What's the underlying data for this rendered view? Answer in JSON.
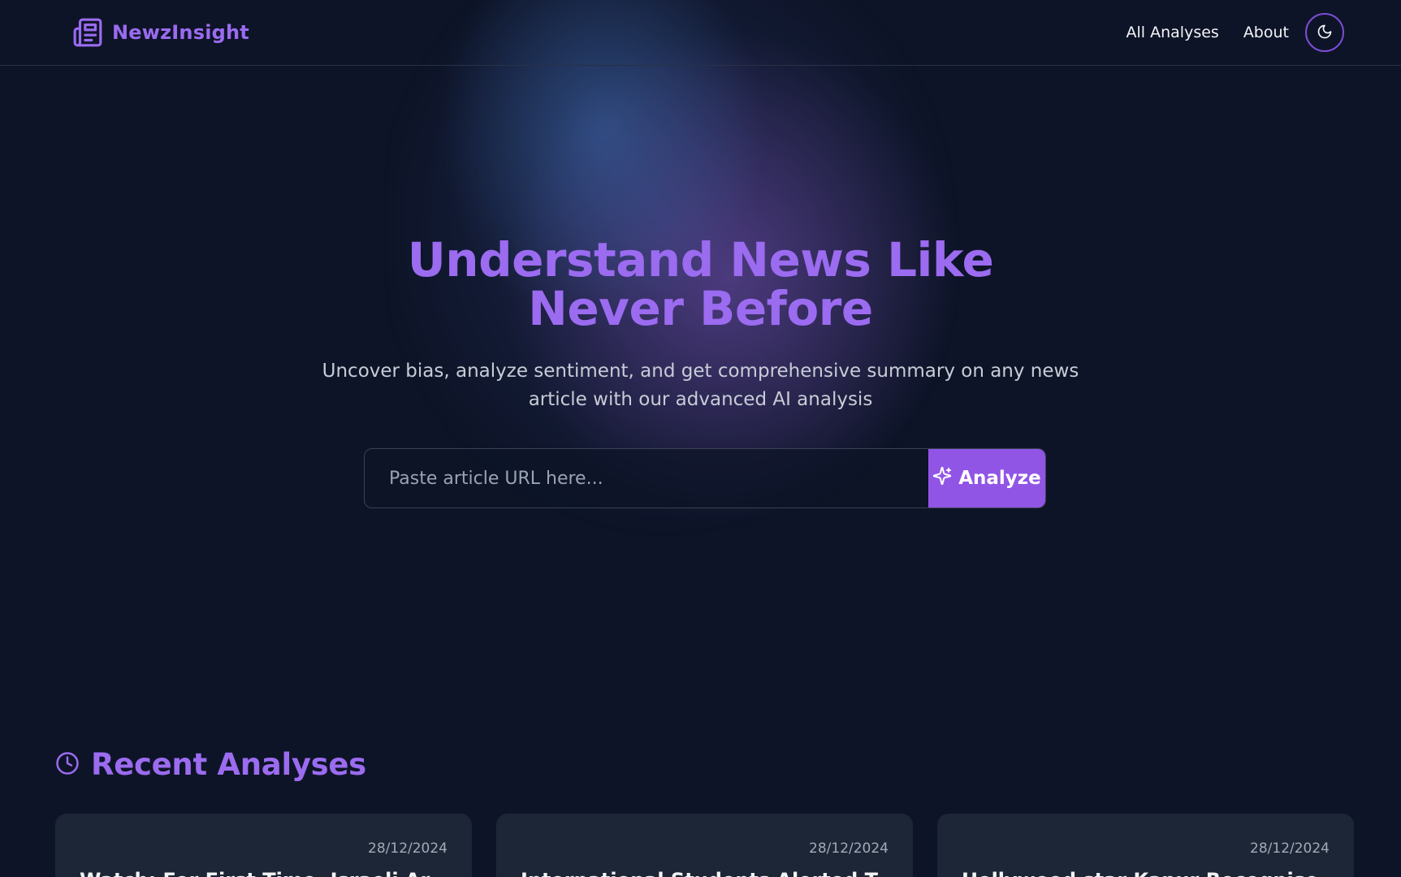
{
  "header": {
    "brand": "NewzInsight",
    "nav": [
      {
        "label": "All Analyses"
      },
      {
        "label": "About"
      }
    ],
    "theme_toggle_icon": "moon-icon"
  },
  "hero": {
    "title": "Understand News Like Never Before",
    "subtitle": "Uncover bias, analyze sentiment, and get comprehensive summary on any news article with our advanced AI analysis",
    "search_placeholder": "Paste article URL here...",
    "search_value": "",
    "analyze_label": "Analyze"
  },
  "recent": {
    "heading": "Recent Analyses",
    "cards": [
      {
        "date": "28/12/2024",
        "title": "Watch: For First Time, Israeli Ar..."
      },
      {
        "date": "28/12/2024",
        "title": "International Students Alerted To Ge..."
      },
      {
        "date": "28/12/2024",
        "title": "Hollywood star Kapur Recognises th..."
      }
    ]
  },
  "colors": {
    "background": "#0d1427",
    "accent": "#9b6bf0",
    "button": "#9155e6",
    "card": "#1d2636"
  }
}
